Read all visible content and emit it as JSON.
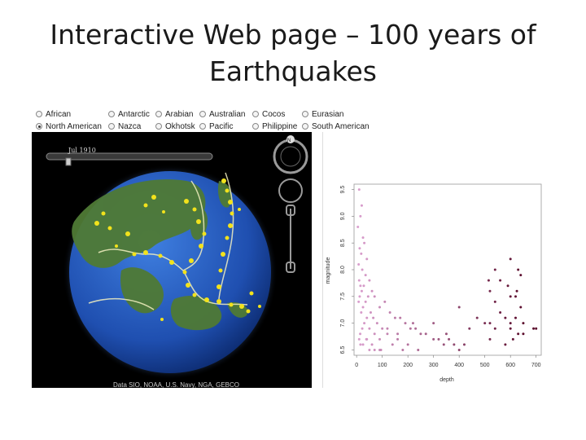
{
  "title": {
    "line1": "Interactive Web page – 100 years of",
    "line2": "Earthquakes"
  },
  "plates": [
    {
      "label": "African",
      "checked": false
    },
    {
      "label": "Antarctic",
      "checked": false
    },
    {
      "label": "Arabian",
      "checked": false
    },
    {
      "label": "Australian",
      "checked": false
    },
    {
      "label": "Cocos",
      "checked": false
    },
    {
      "label": "Eurasian",
      "checked": false
    },
    {
      "label": "North American",
      "checked": true
    },
    {
      "label": "Nazca",
      "checked": false
    },
    {
      "label": "Okhotsk",
      "checked": false
    },
    {
      "label": "Pacific",
      "checked": false
    },
    {
      "label": "Philippine",
      "checked": false
    },
    {
      "label": "South American",
      "checked": false
    }
  ],
  "globe": {
    "timeline_label": "Jul 1910",
    "compass_label": "N",
    "attribution": "Data SIO, NOAA, U.S. Navy, NGA, GEBCO",
    "colors": {
      "ocean": "#1f4fb0",
      "land": "#4f7a35",
      "quake": "#f2e21c",
      "boundary": "#f2efc0"
    }
  },
  "chart_data": {
    "type": "scatter",
    "xlabel": "depth",
    "ylabel": "magnitude",
    "xlim": [
      -10,
      720
    ],
    "ylim": [
      6.4,
      9.6
    ],
    "xticks": [
      0,
      100,
      200,
      300,
      400,
      500,
      600,
      700
    ],
    "yticks": [
      6.5,
      7.0,
      7.5,
      8.0,
      8.5,
      9.0,
      9.5
    ],
    "color_shallow": "#dba0cf",
    "color_deep": "#5b0c2c",
    "x": [
      10,
      20,
      15,
      5,
      25,
      30,
      12,
      18,
      40,
      8,
      22,
      35,
      10,
      50,
      15,
      28,
      60,
      20,
      12,
      45,
      70,
      35,
      8,
      25,
      90,
      110,
      55,
      18,
      40,
      65,
      130,
      150,
      30,
      80,
      170,
      100,
      22,
      50,
      190,
      210,
      14,
      70,
      120,
      230,
      250,
      38,
      90,
      160,
      270,
      300,
      60,
      140,
      200,
      320,
      340,
      360,
      90,
      180,
      240,
      380,
      400,
      420,
      120,
      220,
      300,
      440,
      470,
      500,
      520,
      160,
      350,
      540,
      560,
      580,
      600,
      620,
      640,
      520,
      580,
      610,
      630,
      650,
      540,
      600,
      625,
      560,
      640,
      690,
      15,
      40,
      25,
      70,
      10,
      50,
      95,
      600,
      630,
      590,
      620,
      400,
      520,
      515,
      540,
      600,
      650,
      700
    ],
    "y": [
      9.5,
      9.2,
      9.0,
      8.8,
      8.6,
      8.5,
      8.4,
      8.3,
      8.2,
      8.1,
      8.0,
      7.9,
      7.8,
      7.8,
      7.7,
      7.7,
      7.6,
      7.6,
      7.5,
      7.5,
      7.5,
      7.4,
      7.4,
      7.3,
      7.3,
      7.4,
      7.2,
      7.2,
      7.1,
      7.1,
      7.2,
      7.1,
      7.0,
      7.0,
      7.1,
      6.9,
      6.9,
      6.9,
      7.0,
      6.9,
      6.8,
      6.8,
      6.8,
      6.9,
      6.8,
      6.7,
      6.7,
      6.7,
      6.8,
      6.7,
      6.6,
      6.6,
      6.6,
      6.7,
      6.6,
      6.7,
      6.5,
      6.5,
      6.5,
      6.6,
      6.5,
      6.6,
      6.9,
      7.0,
      7.0,
      6.9,
      7.1,
      7.0,
      7.0,
      6.8,
      6.8,
      6.9,
      7.2,
      7.1,
      7.0,
      7.1,
      7.3,
      6.7,
      6.6,
      6.7,
      6.8,
      7.0,
      7.4,
      7.5,
      7.6,
      7.8,
      7.9,
      6.9,
      6.6,
      6.7,
      6.6,
      6.5,
      6.7,
      6.5,
      6.5,
      8.2,
      8.0,
      7.7,
      7.5,
      7.3,
      7.6,
      7.8,
      8.0,
      6.9,
      6.8,
      6.9
    ]
  }
}
